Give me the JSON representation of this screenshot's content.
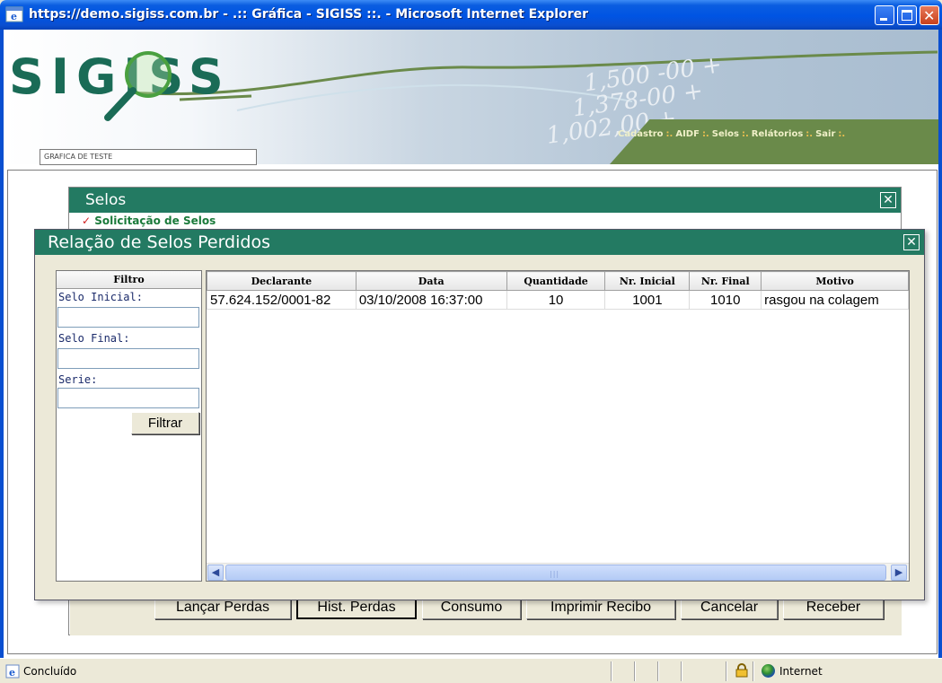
{
  "window": {
    "title": "https://demo.sigiss.com.br - .:: Gráfica - SIGISS ::. - Microsoft Internet Explorer"
  },
  "header": {
    "logo_text": "SIGISS",
    "company_field": "GRAFICA DE TESTE",
    "menu": [
      "Cadastro",
      "AIDF",
      "Selos",
      "Relátorios",
      "Sair"
    ],
    "menu_separator": ":."
  },
  "selos_panel": {
    "title": "Selos",
    "subtitle": "Solicitação de Selos"
  },
  "dialog": {
    "title": "Relação de Selos Perdidos",
    "filter": {
      "header": "Filtro",
      "fields": [
        {
          "label": "Selo Inicial:",
          "value": ""
        },
        {
          "label": "Selo Final:",
          "value": ""
        },
        {
          "label": "Serie:",
          "value": ""
        }
      ],
      "button": "Filtrar"
    },
    "grid": {
      "columns": [
        "Declarante",
        "Data",
        "Quantidade",
        "Nr. Inicial",
        "Nr. Final",
        "Motivo"
      ],
      "rows": [
        [
          "57.624.152/0001-82",
          "03/10/2008 16:37:00",
          "10",
          "1001",
          "1010",
          "rasgou na colagem"
        ]
      ]
    }
  },
  "buttons": [
    "Lançar Perdas",
    "Hist. Perdas",
    "Consumo",
    "Imprimir Recibo",
    "Cancelar",
    "Receber"
  ],
  "active_button": "Hist. Perdas",
  "statusbar": {
    "text": "Concluído",
    "zone": "Internet"
  },
  "colors": {
    "header_green": "#237a62",
    "menu_green": "#6a8a4a",
    "xp_blue": "#0054e3"
  }
}
